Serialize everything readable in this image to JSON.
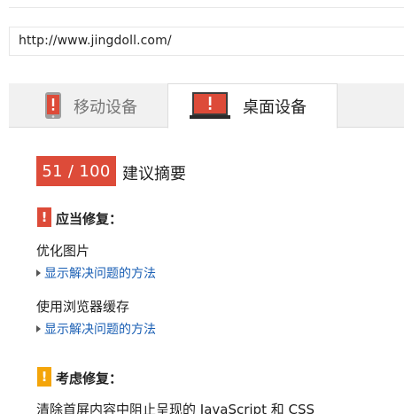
{
  "url_bar": {
    "value": "http://www.jingdoll.com/"
  },
  "tabs": {
    "mobile": {
      "label": "移动设备",
      "icon": "mobile-phone-icon"
    },
    "desktop": {
      "label": "桌面设备",
      "icon": "desktop-monitor-icon",
      "selected": true
    }
  },
  "summary": {
    "score": "51 / 100",
    "title": "建议摘要",
    "score_color": "#dd4b39"
  },
  "should_fix": {
    "icon": "!",
    "title": "应当修复：",
    "color": "#dd4b39",
    "items": [
      {
        "title": "优化图片",
        "link": "显示解决问题的方法"
      },
      {
        "title": "使用浏览器缓存",
        "link": "显示解决问题的方法"
      }
    ]
  },
  "consider_fix": {
    "icon": "!",
    "title": "考虑修复：",
    "color": "#f4a50a",
    "items": [
      {
        "title": "清除首屏内容中阻止呈现的 JavaScript 和 CSS"
      }
    ]
  }
}
